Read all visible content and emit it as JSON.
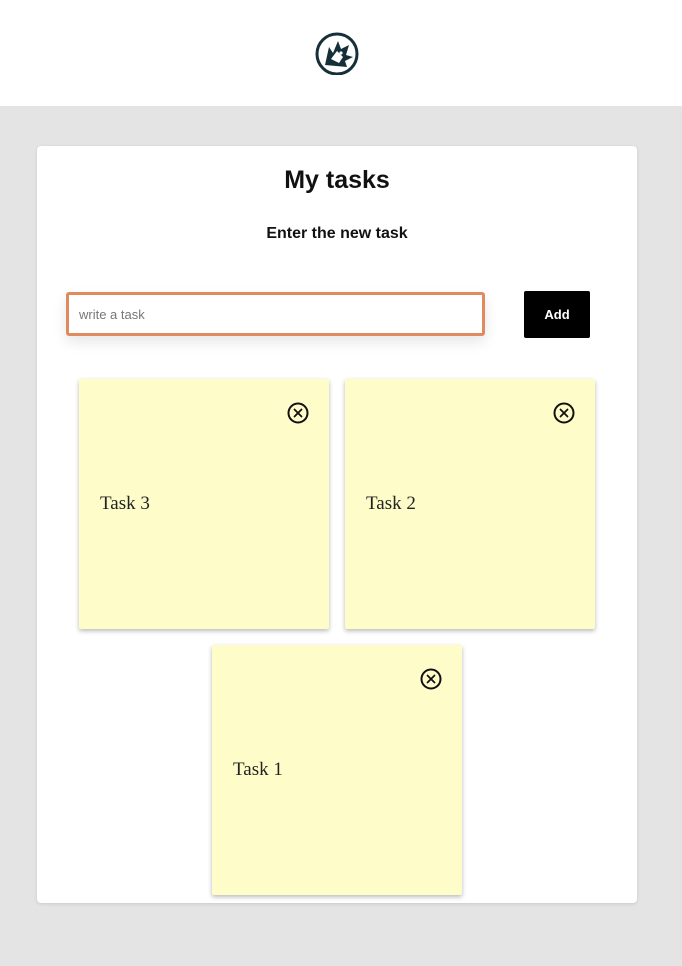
{
  "header": {
    "logo_icon": "wolf-logo-icon"
  },
  "main": {
    "title": "My tasks",
    "subtitle": "Enter the new task",
    "input": {
      "placeholder": "write a task",
      "value": ""
    },
    "add_label": "Add"
  },
  "tasks": [
    {
      "label": "Task 3",
      "close_icon": "close-circle-icon"
    },
    {
      "label": "Task 2",
      "close_icon": "close-circle-icon"
    },
    {
      "label": "Task 1",
      "close_icon": "close-circle-icon"
    }
  ],
  "colors": {
    "page_background": "#e4e4e4",
    "card_background": "#ffffff",
    "note_background": "#fefdc9",
    "input_border": "#e08a60",
    "button_background": "#000000"
  }
}
